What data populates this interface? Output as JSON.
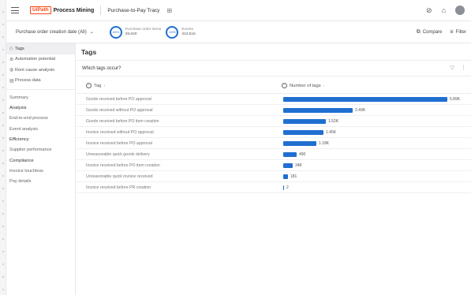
{
  "app": {
    "brand": "UiPath",
    "product": "Process Mining",
    "app_name": "Purchase-to-Pay Tracy"
  },
  "filters": {
    "date_dropdown": "Purchase order creation date (All)",
    "kpis": [
      {
        "ring": "100%",
        "label": "Purchase order items",
        "value": "29,620"
      },
      {
        "ring": "100%",
        "label": "Events",
        "value": "313,516"
      }
    ],
    "compare_label": "Compare",
    "filter_label": "Filter"
  },
  "leftnav": {
    "items": [
      {
        "label": "Tags",
        "icon": "tag-icon",
        "active": true
      },
      {
        "label": "Automation potential",
        "icon": "robot-icon",
        "active": false
      },
      {
        "label": "Root cause analysis",
        "icon": "analysis-icon",
        "active": false
      },
      {
        "label": "Process data",
        "icon": "data-icon",
        "active": false
      }
    ],
    "sections": [
      {
        "label": "Summary",
        "type": "sub"
      },
      {
        "label": "Analysis",
        "type": "group"
      },
      {
        "label": "End-to-end process",
        "type": "sub"
      },
      {
        "label": "Event analysis",
        "type": "sub"
      },
      {
        "label": "Efficiency",
        "type": "group"
      },
      {
        "label": "Supplier performance",
        "type": "sub"
      },
      {
        "label": "Compliance",
        "type": "group"
      },
      {
        "label": "Invoice touchless",
        "type": "sub"
      },
      {
        "label": "Pay details",
        "type": "sub"
      }
    ]
  },
  "main": {
    "title": "Tags",
    "card_title": "Which tags occur?",
    "col_tag": "Tag",
    "col_count": "Number of tags",
    "accent": "#1f6fd1",
    "rows": [
      {
        "tag": "Goods received before PO approval",
        "count": 5890,
        "display": "5.89K"
      },
      {
        "tag": "Goods received without PO approval",
        "count": 2490,
        "display": "2.49K"
      },
      {
        "tag": "Goods received before PO item creation",
        "count": 1520,
        "display": "1.52K"
      },
      {
        "tag": "Invoice received without PO approval",
        "count": 1450,
        "display": "1.45K"
      },
      {
        "tag": "Invoice received before PO approval",
        "count": 1180,
        "display": "1.18K"
      },
      {
        "tag": "Unreasonable quick goods delivery",
        "count": 490,
        "display": "490"
      },
      {
        "tag": "Invoice received before PO item creation",
        "count": 348,
        "display": "348"
      },
      {
        "tag": "Unreasonable quick invoice received",
        "count": 181,
        "display": "181"
      },
      {
        "tag": "Invoice received before PR creation",
        "count": 2,
        "display": "2"
      }
    ]
  }
}
